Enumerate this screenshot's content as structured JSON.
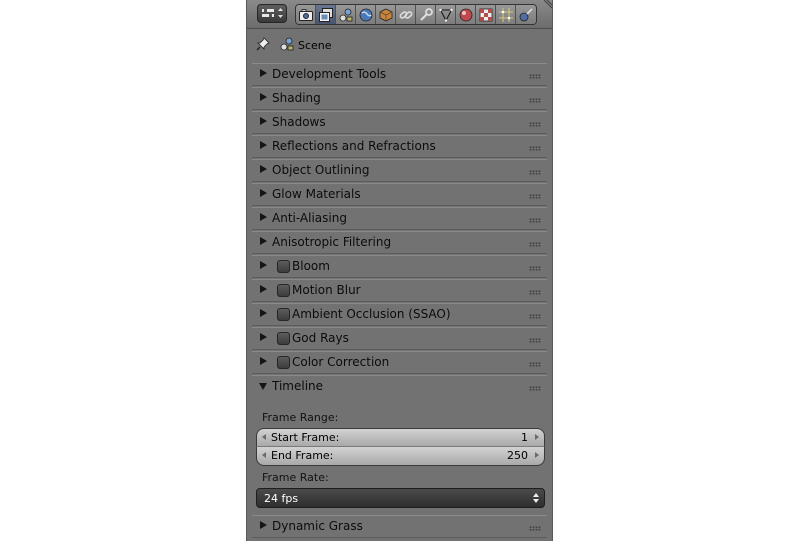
{
  "header": {
    "editor_type_icon": "editor-type-menu-icon",
    "tabs": [
      {
        "icon": "render-icon",
        "active": false
      },
      {
        "icon": "render-layers-icon",
        "active": true
      },
      {
        "icon": "scene-icon",
        "active": false
      },
      {
        "icon": "world-icon",
        "active": false
      },
      {
        "icon": "object-icon",
        "active": false
      },
      {
        "icon": "constraints-icon",
        "active": false
      },
      {
        "icon": "modifiers-icon",
        "active": false
      },
      {
        "icon": "data-icon",
        "active": false
      },
      {
        "icon": "material-icon",
        "active": false
      },
      {
        "icon": "texture-icon",
        "active": false
      },
      {
        "icon": "particles-icon",
        "active": false
      },
      {
        "icon": "physics-icon",
        "active": false
      }
    ]
  },
  "context": {
    "label": "Scene"
  },
  "panels": [
    {
      "label": "Development Tools",
      "checkbox": false,
      "open": false
    },
    {
      "label": "Shading",
      "checkbox": false,
      "open": false
    },
    {
      "label": "Shadows",
      "checkbox": false,
      "open": false
    },
    {
      "label": "Reflections and Refractions",
      "checkbox": false,
      "open": false
    },
    {
      "label": "Object Outlining",
      "checkbox": false,
      "open": false
    },
    {
      "label": "Glow Materials",
      "checkbox": false,
      "open": false
    },
    {
      "label": "Anti-Aliasing",
      "checkbox": false,
      "open": false
    },
    {
      "label": "Anisotropic Filtering",
      "checkbox": false,
      "open": false
    },
    {
      "label": "Bloom",
      "checkbox": true,
      "open": false
    },
    {
      "label": "Motion Blur",
      "checkbox": true,
      "open": false
    },
    {
      "label": "Ambient Occlusion (SSAO)",
      "checkbox": true,
      "open": false
    },
    {
      "label": "God Rays",
      "checkbox": true,
      "open": false
    },
    {
      "label": "Color Correction",
      "checkbox": true,
      "open": false
    },
    {
      "label": "Timeline",
      "checkbox": false,
      "open": true
    },
    {
      "label": "Dynamic Grass",
      "checkbox": false,
      "open": false
    }
  ],
  "timeline": {
    "frame_range_label": "Frame Range:",
    "start_frame": {
      "label": "Start Frame:",
      "value": "1"
    },
    "end_frame": {
      "label": "End Frame:",
      "value": "250"
    },
    "frame_rate_label": "Frame Rate:",
    "frame_rate_value": "24 fps"
  }
}
